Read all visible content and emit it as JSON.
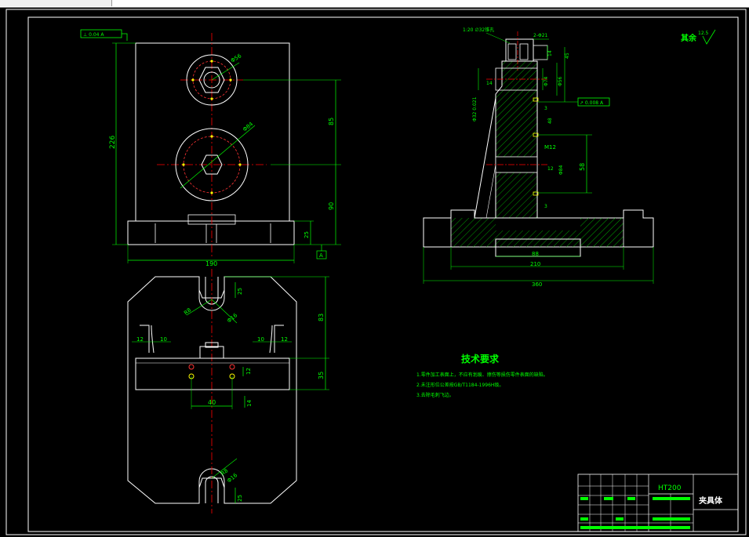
{
  "window": {
    "title": ""
  },
  "colors": {
    "background": "#000000",
    "outline": "#ffffff",
    "dimension": "#00ff00",
    "center": "#ff0000",
    "accent": "#ffff00",
    "hatch": "#00ff00"
  },
  "front_view": {
    "flatness_box": "⊥ 0.04 A",
    "dim_height": "226",
    "dim_width": "190",
    "dim_upper_hole": "Φ56",
    "dim_lower_hole": "Φ84",
    "dim_center_dist": "85",
    "dim_lower_height": "90",
    "dim_base": "25",
    "datum_label": "A"
  },
  "top_view": {
    "dim_slot_top": "25",
    "dim_r_top": "R8",
    "dim_phi_top": "Φ16",
    "dim_height": "83",
    "dim_lower": "35",
    "dim_12_left": "12",
    "dim_10_left": "10",
    "dim_10_right": "10",
    "dim_12_right": "12",
    "dim_hole_gap": "12",
    "dim_40": "40",
    "dim_14": "14",
    "dim_r_bottom": "R8",
    "dim_phi_bottom": "Φ16",
    "dim_25_bottom": "25"
  },
  "section_view": {
    "thread_label": "1:20 ∅32锥孔",
    "dim_top": "2-Φ21",
    "dim_14": "14",
    "dim_phi_a": "Φ74",
    "dim_phi_b": "Φ56",
    "dim_phi_c": "Φ32 0.021",
    "dim_side": "45",
    "runout_box": "↗ 0.008 A",
    "dim_m": "M12",
    "dim_48": "48",
    "dim_12": "12",
    "dim_14b": "14",
    "dim_phi_d": "Φ84",
    "dim_58": "58",
    "dim_3a": "3",
    "dim_3b": "3",
    "dim_88": "88",
    "dim_210": "210",
    "dim_360": "360"
  },
  "roughness": {
    "label": "其余",
    "value": "12.5"
  },
  "tech": {
    "title": "技术要求",
    "line1": "1.零件加工表面上，不应有划痕、擦伤等损伤零件表面的缺陷。",
    "line2": "2.未注形位公差按GB/T1184-1996H级。",
    "line3": "3.去除毛刺飞边。"
  },
  "title_block": {
    "material": "HT200",
    "part_name": "夹具体"
  }
}
